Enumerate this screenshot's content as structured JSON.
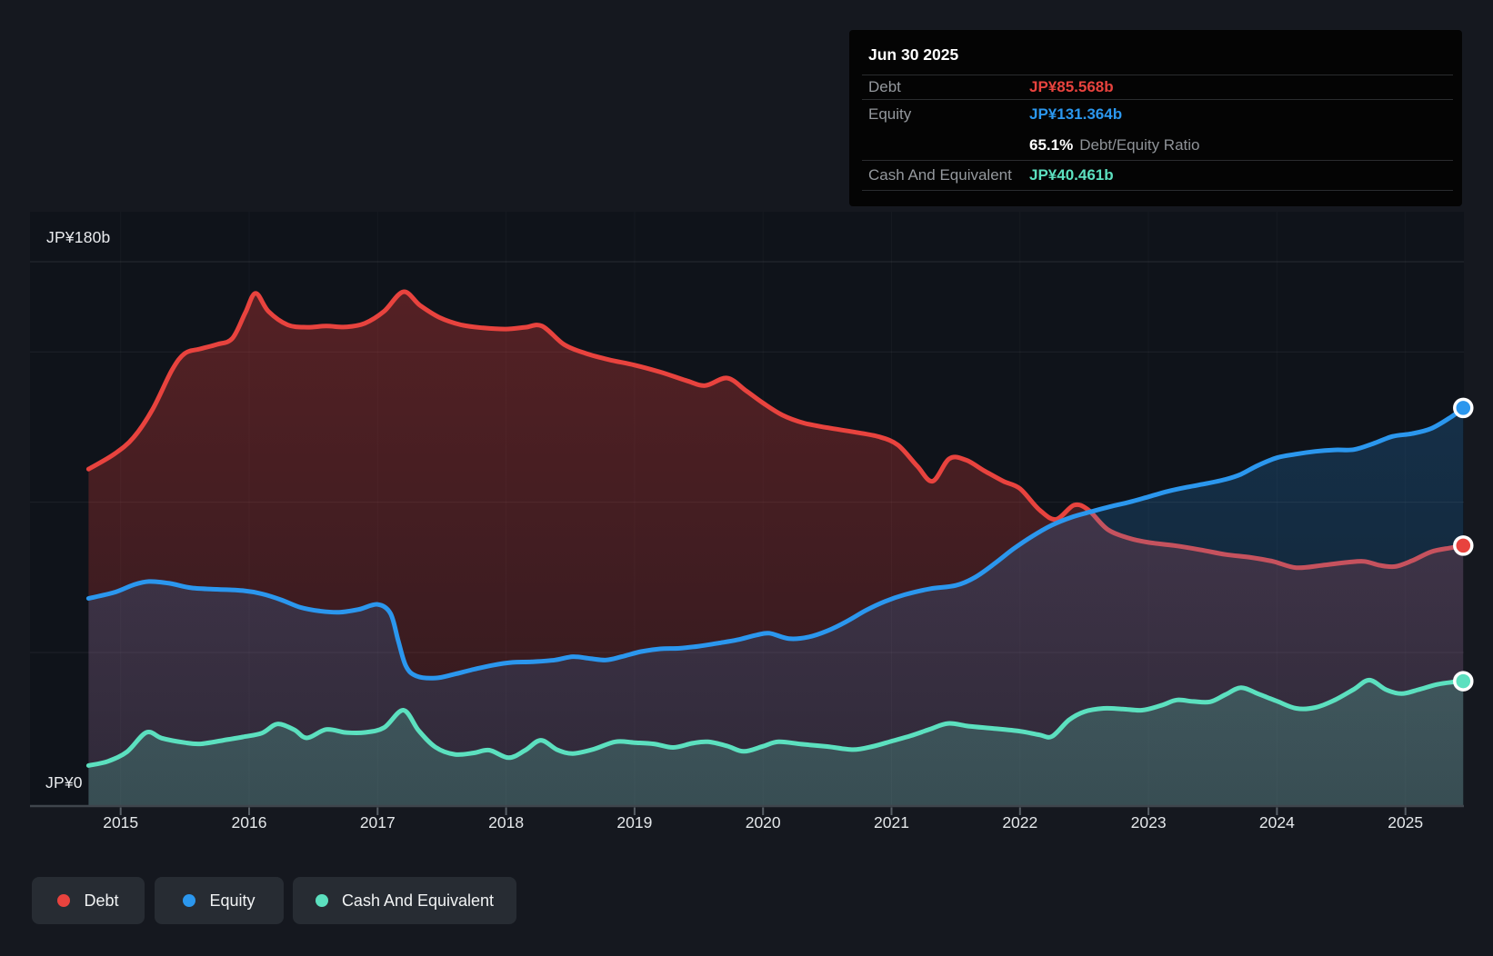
{
  "colors": {
    "background": "#15181f",
    "plot_background": "#0f131a"
  },
  "y_axis": {
    "top_label": "JP¥180b",
    "bottom_label": "JP¥0"
  },
  "tooltip": {
    "date": "Jun 30 2025",
    "debt_label": "Debt",
    "debt_value": "JP¥85.568b",
    "equity_label": "Equity",
    "equity_value": "JP¥131.364b",
    "ratio_value": "65.1%",
    "ratio_label": "Debt/Equity Ratio",
    "cash_label": "Cash And Equivalent",
    "cash_value": "JP¥40.461b"
  },
  "legend": {
    "items": [
      {
        "label": "Debt"
      },
      {
        "label": "Equity"
      },
      {
        "label": "Cash And Equivalent"
      }
    ]
  },
  "chart_data": {
    "type": "area",
    "x_tick_labels": [
      "2015",
      "2016",
      "2017",
      "2018",
      "2019",
      "2020",
      "2021",
      "2022",
      "2023",
      "2024",
      "2025"
    ],
    "x_ticks": [
      2015,
      2016,
      2017,
      2018,
      2019,
      2020,
      2021,
      2022,
      2023,
      2024,
      2025
    ],
    "x_range": [
      2014.75,
      2025.45
    ],
    "y_range": [
      0,
      180
    ],
    "y_unit": "JP¥ billions",
    "y_gridline_values": [
      180,
      150,
      100,
      50
    ],
    "grid": true,
    "legend_position": "bottom-left",
    "series": [
      {
        "name": "Debt",
        "color": "#e8433e",
        "end_value": 85.568,
        "points": [
          [
            2014.75,
            111
          ],
          [
            2014.95,
            116
          ],
          [
            2015.1,
            121.5
          ],
          [
            2015.25,
            131
          ],
          [
            2015.4,
            144
          ],
          [
            2015.5,
            149.5
          ],
          [
            2015.62,
            151
          ],
          [
            2015.75,
            152.5
          ],
          [
            2015.87,
            154.5
          ],
          [
            2015.97,
            163
          ],
          [
            2016.05,
            169.5
          ],
          [
            2016.15,
            163.5
          ],
          [
            2016.3,
            159
          ],
          [
            2016.45,
            158.2
          ],
          [
            2016.6,
            158.6
          ],
          [
            2016.75,
            158.3
          ],
          [
            2016.9,
            159.5
          ],
          [
            2017.05,
            163.5
          ],
          [
            2017.2,
            170
          ],
          [
            2017.33,
            165.5
          ],
          [
            2017.48,
            161.5
          ],
          [
            2017.65,
            159
          ],
          [
            2017.82,
            158
          ],
          [
            2018.0,
            157.6
          ],
          [
            2018.15,
            158.2
          ],
          [
            2018.28,
            158.6
          ],
          [
            2018.45,
            152.5
          ],
          [
            2018.62,
            149.5
          ],
          [
            2018.8,
            147.4
          ],
          [
            2019.0,
            145.6
          ],
          [
            2019.2,
            143.3
          ],
          [
            2019.4,
            140.5
          ],
          [
            2019.55,
            138.8
          ],
          [
            2019.72,
            141.3
          ],
          [
            2019.87,
            137
          ],
          [
            2020.0,
            133
          ],
          [
            2020.15,
            129
          ],
          [
            2020.32,
            126.3
          ],
          [
            2020.5,
            124.8
          ],
          [
            2020.7,
            123.4
          ],
          [
            2020.9,
            121.8
          ],
          [
            2021.05,
            119
          ],
          [
            2021.2,
            112
          ],
          [
            2021.32,
            107
          ],
          [
            2021.45,
            114.5
          ],
          [
            2021.58,
            114
          ],
          [
            2021.72,
            110.5
          ],
          [
            2021.87,
            107
          ],
          [
            2022.0,
            104.5
          ],
          [
            2022.15,
            97.5
          ],
          [
            2022.28,
            94.3
          ],
          [
            2022.42,
            99
          ],
          [
            2022.53,
            97.5
          ],
          [
            2022.68,
            91
          ],
          [
            2022.85,
            88
          ],
          [
            2023.0,
            86.6
          ],
          [
            2023.2,
            85.6
          ],
          [
            2023.4,
            84.2
          ],
          [
            2023.6,
            82.6
          ],
          [
            2023.8,
            81.6
          ],
          [
            2023.97,
            80.3
          ],
          [
            2024.15,
            78.2
          ],
          [
            2024.35,
            79
          ],
          [
            2024.55,
            80
          ],
          [
            2024.68,
            80.3
          ],
          [
            2024.8,
            79
          ],
          [
            2024.92,
            78.6
          ],
          [
            2025.05,
            80.5
          ],
          [
            2025.2,
            83.5
          ],
          [
            2025.35,
            84.8
          ],
          [
            2025.45,
            85.568
          ]
        ]
      },
      {
        "name": "Equity",
        "color": "#2b97ee",
        "end_value": 131.364,
        "points": [
          [
            2014.75,
            68
          ],
          [
            2014.95,
            70
          ],
          [
            2015.1,
            72.5
          ],
          [
            2015.22,
            73.6
          ],
          [
            2015.38,
            73
          ],
          [
            2015.55,
            71.5
          ],
          [
            2015.75,
            71
          ],
          [
            2015.95,
            70.6
          ],
          [
            2016.1,
            69.5
          ],
          [
            2016.25,
            67.5
          ],
          [
            2016.4,
            65
          ],
          [
            2016.55,
            63.8
          ],
          [
            2016.7,
            63.4
          ],
          [
            2016.85,
            64.3
          ],
          [
            2017.0,
            66
          ],
          [
            2017.1,
            63
          ],
          [
            2017.16,
            54
          ],
          [
            2017.22,
            45.5
          ],
          [
            2017.3,
            42.2
          ],
          [
            2017.45,
            41.5
          ],
          [
            2017.6,
            42.8
          ],
          [
            2017.75,
            44.4
          ],
          [
            2017.9,
            45.8
          ],
          [
            2018.05,
            46.7
          ],
          [
            2018.2,
            46.9
          ],
          [
            2018.38,
            47.5
          ],
          [
            2018.52,
            48.6
          ],
          [
            2018.65,
            48
          ],
          [
            2018.78,
            47.5
          ],
          [
            2018.9,
            48.6
          ],
          [
            2019.05,
            50.3
          ],
          [
            2019.2,
            51.2
          ],
          [
            2019.35,
            51.4
          ],
          [
            2019.5,
            52.1
          ],
          [
            2019.65,
            53.1
          ],
          [
            2019.8,
            54.2
          ],
          [
            2019.95,
            55.8
          ],
          [
            2020.05,
            56.4
          ],
          [
            2020.2,
            54.6
          ],
          [
            2020.35,
            55.1
          ],
          [
            2020.5,
            57.2
          ],
          [
            2020.65,
            60.3
          ],
          [
            2020.8,
            64
          ],
          [
            2020.95,
            67
          ],
          [
            2021.1,
            69.2
          ],
          [
            2021.3,
            71.2
          ],
          [
            2021.5,
            72.3
          ],
          [
            2021.65,
            75
          ],
          [
            2021.8,
            79.5
          ],
          [
            2021.95,
            84.5
          ],
          [
            2022.1,
            88.8
          ],
          [
            2022.25,
            92.4
          ],
          [
            2022.4,
            95
          ],
          [
            2022.55,
            96.8
          ],
          [
            2022.7,
            98.5
          ],
          [
            2022.85,
            100
          ],
          [
            2023.0,
            101.8
          ],
          [
            2023.15,
            103.6
          ],
          [
            2023.3,
            105
          ],
          [
            2023.45,
            106.2
          ],
          [
            2023.6,
            107.6
          ],
          [
            2023.72,
            109.3
          ],
          [
            2023.85,
            112.2
          ],
          [
            2024.0,
            114.8
          ],
          [
            2024.15,
            116
          ],
          [
            2024.3,
            116.9
          ],
          [
            2024.45,
            117.4
          ],
          [
            2024.6,
            117.5
          ],
          [
            2024.75,
            119.5
          ],
          [
            2024.9,
            121.9
          ],
          [
            2025.05,
            122.8
          ],
          [
            2025.2,
            124.5
          ],
          [
            2025.35,
            128.2
          ],
          [
            2025.45,
            131.364
          ]
        ]
      },
      {
        "name": "Cash And Equivalent",
        "color": "#5ce0bf",
        "end_value": 40.461,
        "points": [
          [
            2014.75,
            12.4
          ],
          [
            2014.9,
            13.8
          ],
          [
            2015.05,
            17
          ],
          [
            2015.2,
            23.4
          ],
          [
            2015.32,
            21.5
          ],
          [
            2015.5,
            20
          ],
          [
            2015.62,
            19.6
          ],
          [
            2015.8,
            20.8
          ],
          [
            2015.95,
            21.9
          ],
          [
            2016.1,
            23.2
          ],
          [
            2016.22,
            26.2
          ],
          [
            2016.35,
            24.3
          ],
          [
            2016.45,
            21.6
          ],
          [
            2016.6,
            24.4
          ],
          [
            2016.75,
            23.4
          ],
          [
            2016.9,
            23.4
          ],
          [
            2017.05,
            25
          ],
          [
            2017.2,
            30.8
          ],
          [
            2017.32,
            24
          ],
          [
            2017.45,
            18.5
          ],
          [
            2017.6,
            16.1
          ],
          [
            2017.75,
            16.6
          ],
          [
            2017.87,
            17.5
          ],
          [
            2018.02,
            15
          ],
          [
            2018.15,
            17.5
          ],
          [
            2018.27,
            20.8
          ],
          [
            2018.4,
            17.6
          ],
          [
            2018.52,
            16.4
          ],
          [
            2018.68,
            17.8
          ],
          [
            2018.85,
            20.3
          ],
          [
            2019.0,
            20
          ],
          [
            2019.15,
            19.6
          ],
          [
            2019.3,
            18.4
          ],
          [
            2019.45,
            19.8
          ],
          [
            2019.57,
            20.3
          ],
          [
            2019.72,
            18.9
          ],
          [
            2019.85,
            17.1
          ],
          [
            2020.0,
            18.8
          ],
          [
            2020.12,
            20.3
          ],
          [
            2020.3,
            19.5
          ],
          [
            2020.5,
            18.7
          ],
          [
            2020.7,
            17.7
          ],
          [
            2020.85,
            18.7
          ],
          [
            2021.0,
            20.5
          ],
          [
            2021.15,
            22.3
          ],
          [
            2021.3,
            24.5
          ],
          [
            2021.44,
            26.4
          ],
          [
            2021.6,
            25.5
          ],
          [
            2021.8,
            24.7
          ],
          [
            2022.0,
            23.8
          ],
          [
            2022.15,
            22.6
          ],
          [
            2022.25,
            22.1
          ],
          [
            2022.38,
            27.5
          ],
          [
            2022.5,
            30.3
          ],
          [
            2022.65,
            31.4
          ],
          [
            2022.8,
            31.2
          ],
          [
            2022.95,
            30.8
          ],
          [
            2023.1,
            32.4
          ],
          [
            2023.22,
            34.2
          ],
          [
            2023.35,
            33.7
          ],
          [
            2023.48,
            33.6
          ],
          [
            2023.6,
            36
          ],
          [
            2023.72,
            38.3
          ],
          [
            2023.85,
            36.3
          ],
          [
            2024.0,
            33.8
          ],
          [
            2024.15,
            31.4
          ],
          [
            2024.3,
            31.7
          ],
          [
            2024.45,
            34.2
          ],
          [
            2024.6,
            37.8
          ],
          [
            2024.72,
            40.8
          ],
          [
            2024.85,
            37.6
          ],
          [
            2024.97,
            36.3
          ],
          [
            2025.1,
            37.6
          ],
          [
            2025.25,
            39.4
          ],
          [
            2025.38,
            40.2
          ],
          [
            2025.45,
            40.461
          ]
        ]
      }
    ]
  }
}
